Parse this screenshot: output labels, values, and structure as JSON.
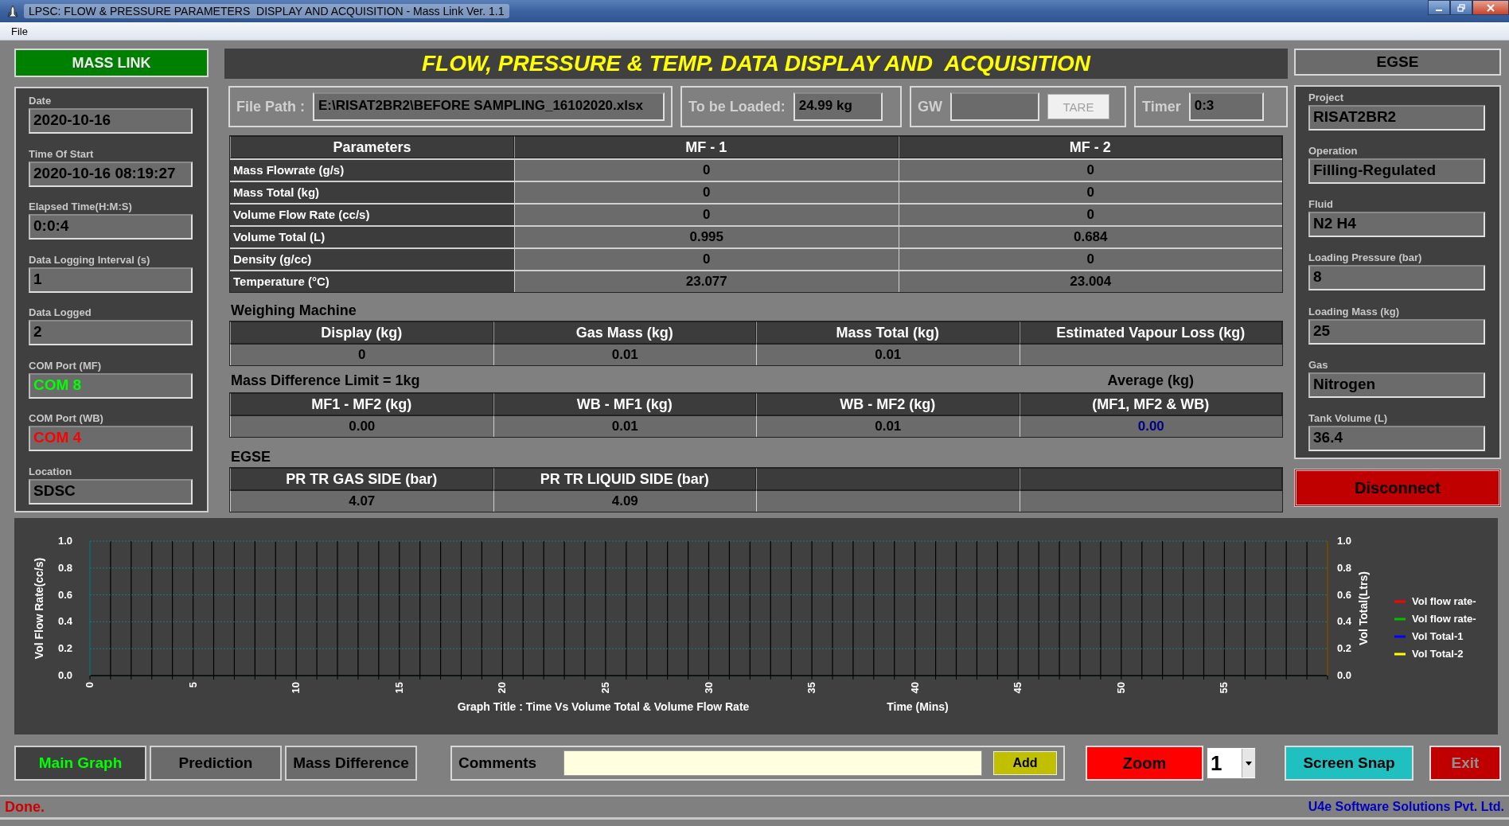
{
  "window": {
    "title": "LPSC: FLOW & PRESSURE PARAMETERS  DISPLAY AND ACQUISITION - Mass Link Ver. 1.1"
  },
  "menu": [
    "File"
  ],
  "brand": "MASS LINK",
  "header": "FLOW, PRESSURE & TEMP. DATA DISPLAY AND  ACQUISITION",
  "left_fields": [
    {
      "label": "Date",
      "value": "2020-10-16"
    },
    {
      "label": "Time Of Start",
      "value": "2020-10-16 08:19:27"
    },
    {
      "label": "Elapsed Time(H:M:S)",
      "value": "0:0:4"
    },
    {
      "label": "Data Logging Interval (s)",
      "value": "1"
    },
    {
      "label": "Data Logged",
      "value": "2"
    },
    {
      "label": "COM Port (MF)",
      "value": "COM 8",
      "color": "#00ff00"
    },
    {
      "label": "COM Port (WB)",
      "value": "COM 4",
      "color": "#ff0000"
    },
    {
      "label": "Location",
      "value": "SDSC"
    }
  ],
  "file_path": {
    "label": "File Path :",
    "value": "E:\\RISAT2BR2\\BEFORE SAMPLING_16102020.xlsx"
  },
  "to_be_loaded": {
    "label": "To be Loaded:",
    "value": "24.99 kg"
  },
  "gw": {
    "label": "GW",
    "button": "TARE",
    "disabled": true
  },
  "timer": {
    "label": "Timer",
    "value": "0:3"
  },
  "parameters": {
    "columns": [
      "Parameters",
      "MF - 1",
      "MF - 2"
    ],
    "rows": [
      {
        "name": "Mass Flowrate (g/s)",
        "values": [
          "0",
          "0"
        ]
      },
      {
        "name": "Mass Total (kg)",
        "values": [
          "0",
          "0"
        ]
      },
      {
        "name": "Volume Flow Rate (cc/s)",
        "values": [
          "0",
          "0"
        ]
      },
      {
        "name": "Volume Total (L)",
        "values": [
          "0.995",
          "0.684"
        ]
      },
      {
        "name": "Density (g/cc)",
        "values": [
          "0",
          "0"
        ]
      },
      {
        "name": "Temperature (°C)",
        "values": [
          "23.077",
          "23.004"
        ]
      }
    ]
  },
  "weighing": {
    "title": "Weighing Machine",
    "columns": [
      {
        "header": "Display (kg)",
        "value": "0"
      },
      {
        "header": "Gas Mass (kg)",
        "value": "0.01"
      },
      {
        "header": "Mass Total (kg)",
        "value": "0.01"
      },
      {
        "header": "Estimated Vapour Loss (kg)"
      }
    ]
  },
  "mass_difference": {
    "title": "Mass Difference Limit = 1kg",
    "average_label": "Average (kg)",
    "columns": [
      {
        "header": "MF1 - MF2 (kg)",
        "value": "0.00",
        "color": "#000000"
      },
      {
        "header": "WB - MF1 (kg)",
        "value": "0.01",
        "color": "#000000"
      },
      {
        "header": "WB - MF2 (kg)",
        "value": "0.01",
        "color": "#000000"
      },
      {
        "header": "(MF1, MF2 & WB)",
        "value": "0.00",
        "color": "#000080"
      }
    ]
  },
  "egse": {
    "title": "EGSE",
    "columns": [
      {
        "header": "PR TR GAS SIDE (bar)",
        "value": "4.07"
      },
      {
        "header": "PR TR LIQUID SIDE (bar)",
        "value": "4.09"
      }
    ]
  },
  "right_title": "EGSE",
  "right_fields": [
    {
      "label": "Project",
      "value": "RISAT2BR2"
    },
    {
      "label": "Operation",
      "value": "Filling-Regulated"
    },
    {
      "label": "Fluid",
      "value": "N2 H4"
    },
    {
      "label": "Loading Pressure (bar)",
      "value": "8"
    },
    {
      "label": "Loading Mass (kg)",
      "value": "25"
    },
    {
      "label": "Gas",
      "value": "Nitrogen"
    },
    {
      "label": "Tank Volume (L)",
      "value": "36.4"
    }
  ],
  "disconnect": "Disconnect",
  "graph": {
    "chart_data": {
      "type": "line",
      "title": "Graph Title : Time Vs Volume Total & Volume Flow Rate",
      "xlabel": "Time (Mins)",
      "ylabel": "Vol Flow Rate(cc/s)",
      "ylim": [
        0,
        1
      ],
      "grid": true,
      "categories": [
        "0",
        "5",
        "10",
        "15",
        "20",
        "25",
        "30",
        "35",
        "40",
        "45",
        "50",
        "55"
      ],
      "yticks": [
        {
          "value": 0,
          "label": "0.0"
        },
        {
          "value": 0.2,
          "label": "0.2"
        },
        {
          "value": 0.4,
          "label": "0.4"
        },
        {
          "value": 0.6,
          "label": "0.6"
        },
        {
          "value": 0.8,
          "label": "0.8"
        },
        {
          "value": 1,
          "label": "1.0"
        }
      ],
      "series": [
        {
          "name": "Vol flow rate-",
          "color": "#ff0000",
          "values": [
            null,
            null,
            null,
            null,
            null,
            null,
            null,
            null,
            null,
            null,
            null,
            null
          ]
        },
        {
          "name": "Vol flow rate-",
          "color": "#00c000",
          "values": [
            null,
            null,
            null,
            null,
            null,
            null,
            null,
            null,
            null,
            null,
            null,
            null
          ]
        },
        {
          "name": "Vol Total-1",
          "color": "#0000ff",
          "values": [
            null,
            null,
            null,
            null,
            null,
            null,
            null,
            null,
            null,
            null,
            null,
            null
          ]
        },
        {
          "name": "Vol Total-2",
          "color": "#ffff00",
          "values": [
            null,
            null,
            null,
            null,
            null,
            null,
            null,
            null,
            null,
            null,
            null,
            null
          ]
        }
      ]
    },
    "right_axis": {
      "label": "Vol Total(Ltrs)",
      "ticks": [
        "1.0",
        "0.8",
        "0.6",
        "0.4",
        "0.2",
        "0.0"
      ]
    }
  },
  "tabs": [
    {
      "label": "Main Graph",
      "selected": true
    },
    {
      "label": "Prediction",
      "selected": false
    },
    {
      "label": "Mass Difference",
      "selected": false
    }
  ],
  "comments": {
    "label": "Comments",
    "button": "Add"
  },
  "zoom": {
    "button": "Zoom",
    "value": "1"
  },
  "screen_snap": "Screen Snap",
  "exit": {
    "label": "Exit",
    "disabled": true
  },
  "status": {
    "message": "Done.",
    "vendor": "U4e Software Solutions Pvt. Ltd."
  }
}
